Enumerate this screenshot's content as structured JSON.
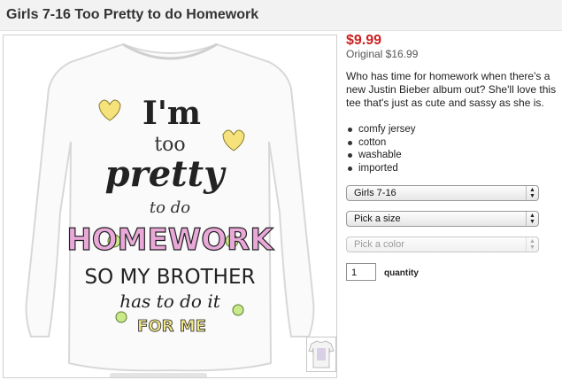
{
  "product": {
    "title": "Girls 7-16 Too Pretty to do Homework",
    "price": "$9.99",
    "original_price": "Original $16.99",
    "description": "Who has time for homework when there's a new Justin Bieber album out? She'll love this tee that's just as cute and sassy as she is.",
    "features": [
      "comfy jersey",
      "cotton",
      "washable",
      "imported"
    ]
  },
  "shirt_print": {
    "line1": "I'm",
    "line2": "too",
    "line3": "pretty",
    "line4": "to do",
    "line5": "HOMEWORK",
    "line6": "SO MY BROTHER",
    "line7": "has to do it",
    "line8": "FOR ME"
  },
  "options": {
    "size_group": "Girls 7-16",
    "size": "Pick a size",
    "color": "Pick a color"
  },
  "quantity": {
    "value": "1",
    "label": "quantity"
  },
  "colors": {
    "price": "#cc1f1f",
    "title_bar": "#f2f2f2"
  },
  "icons": {
    "select_arrows": "updown-arrows-icon"
  }
}
